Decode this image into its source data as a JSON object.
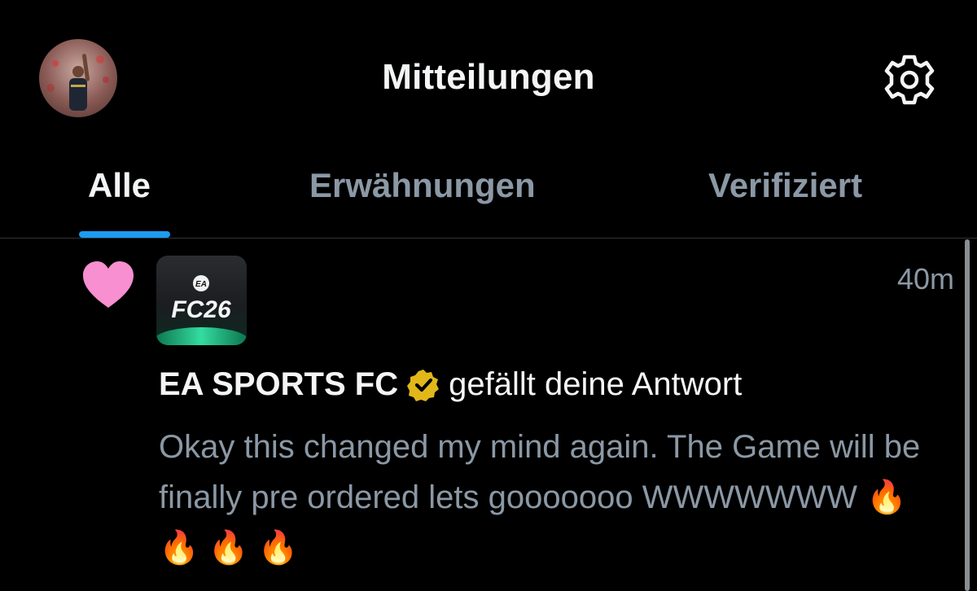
{
  "header": {
    "title": "Mitteilungen",
    "avatar_icon": "profile-avatar",
    "settings_icon": "gear-icon"
  },
  "tabs": [
    {
      "label": "Alle",
      "active": true
    },
    {
      "label": "Erwähnungen",
      "active": false
    },
    {
      "label": "Verifiziert",
      "active": false
    }
  ],
  "notification": {
    "icon": "heart-icon",
    "app_logo": {
      "brand_small": "EA",
      "brand_text": "FC26"
    },
    "time": "40m",
    "account_name": "EA SPORTS FC",
    "verified_badge": "gold-verified-badge-icon",
    "action": "gefällt deine Antwort",
    "text": "Okay this changed my mind again. The Game will be finally pre ordered lets gooooooo WWWWWWW 🔥 🔥 🔥 🔥"
  },
  "colors": {
    "background": "#000000",
    "accent": "#1d9bf0",
    "heart": "#f78fd0",
    "verified": "#e2b719",
    "muted_text": "#8b98a5"
  }
}
